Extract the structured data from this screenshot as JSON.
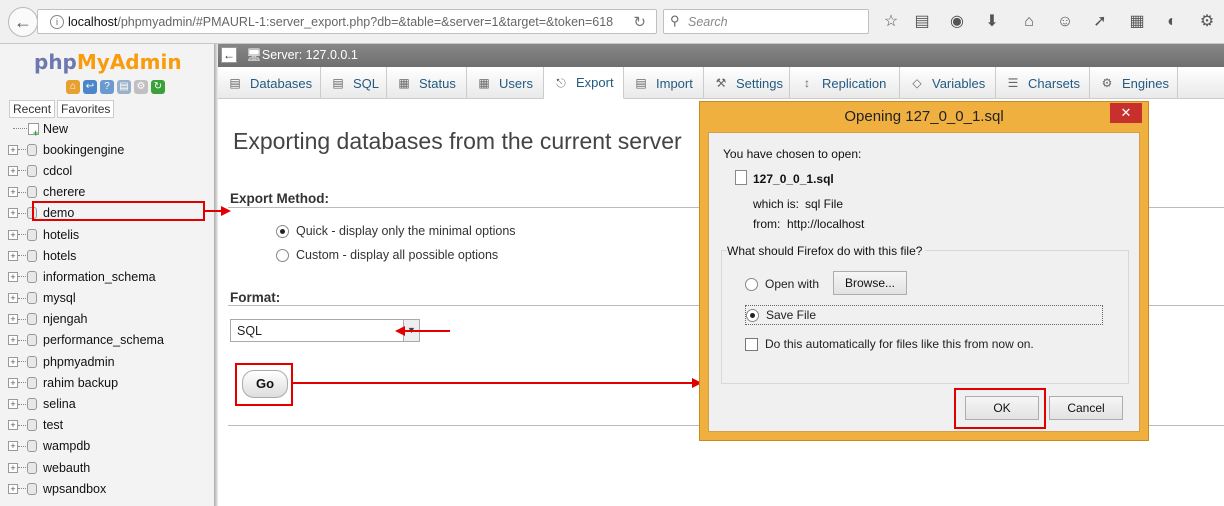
{
  "browser": {
    "url_prefix": "localhost",
    "url_rest": "/phpmyadmin/#PMAURL-1:server_export.php?db=&table=&server=1&target=&token=618",
    "search_placeholder": "Search"
  },
  "nav": {
    "logo_php": "php",
    "logo_my": "My",
    "logo_admin": "Admin",
    "recent_tab": "Recent",
    "favorites_tab": "Favorites",
    "new_label": "New",
    "databases": [
      "bookingengine",
      "cdcol",
      "cherere",
      "demo",
      "hotelis",
      "hotels",
      "information_schema",
      "mysql",
      "njengah",
      "performance_schema",
      "phpmyadmin",
      "rahim backup",
      "selina",
      "test",
      "wampdb",
      "webauth",
      "wpsandbox"
    ]
  },
  "server": {
    "label": "Server: 127.0.0.1"
  },
  "tabs": [
    "Databases",
    "SQL",
    "Status",
    "Users",
    "Export",
    "Import",
    "Settings",
    "Replication",
    "Variables",
    "Charsets",
    "Engines"
  ],
  "main": {
    "title": "Exporting databases from the current server",
    "export_method_label": "Export Method:",
    "quick_option": "Quick - display only the minimal options",
    "custom_option": "Custom - display all possible options",
    "format_label": "Format:",
    "format_value": "SQL",
    "go_label": "Go"
  },
  "dialog": {
    "title": "Opening 127_0_0_1.sql",
    "chosen_text": "You have chosen to open:",
    "filename": "127_0_0_1.sql",
    "which_is_label": "which is:",
    "which_is_value": "sql File",
    "from_label": "from:",
    "from_value": "http://localhost",
    "question": "What should Firefox do with this file?",
    "open_with": "Open with",
    "browse": "Browse...",
    "save_file": "Save File",
    "auto_text": "Do this automatically for files like this from now on.",
    "ok": "OK",
    "cancel": "Cancel"
  },
  "colors": {
    "accent_red": "#e00000",
    "link_blue": "#235a81",
    "dialog_frame": "#f0b040"
  }
}
